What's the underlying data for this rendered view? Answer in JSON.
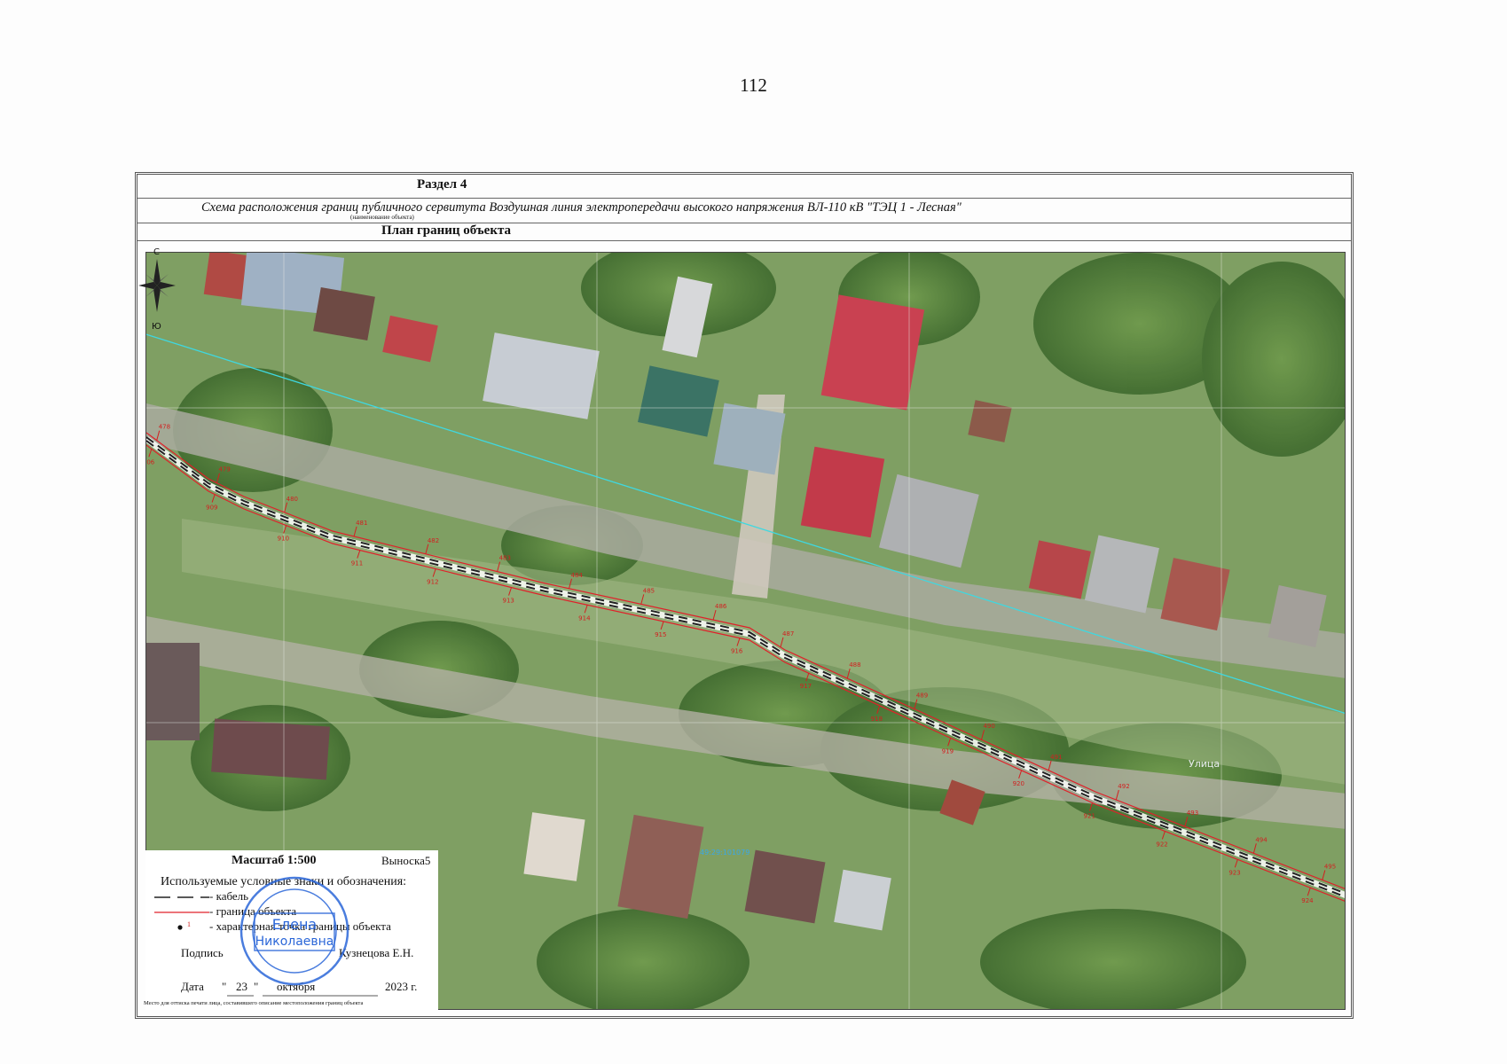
{
  "page_number": "112",
  "header": {
    "section": "Раздел 4",
    "object_name": "Схема расположения границ публичного сервитута Воздушная линия электропередачи высокого напряжения ВЛ-110 кВ \"ТЭЦ 1 - Лесная\"",
    "object_caption": "(наименование объекта)",
    "plan_title": "План границ объекта"
  },
  "compass": {
    "north": "С",
    "south": "Ю"
  },
  "map": {
    "points_upper": [
      "478",
      "479",
      "480",
      "481",
      "482",
      "483",
      "484",
      "485",
      "486",
      "487",
      "488",
      "489",
      "490",
      "491",
      "492",
      "493",
      "494",
      "495"
    ],
    "points_lower": [
      "906",
      "909",
      "910",
      "911",
      "912",
      "913",
      "914",
      "915",
      "916",
      "917",
      "918",
      "919",
      "920",
      "921",
      "922",
      "923",
      "924"
    ],
    "street_label": "Улица",
    "parcel_label": "49:29:101079",
    "colors": {
      "cable": "#222222",
      "boundary": "#e0202a",
      "road_line": "#3fd8e0",
      "label": "#d22020"
    }
  },
  "legend": {
    "scale": "Масштаб 1:500",
    "callout": "Выноска5",
    "title": "Используемые условные знаки и обозначения:",
    "items": [
      {
        "symbol": "dashed-line",
        "text": "- кабель"
      },
      {
        "symbol": "red-line",
        "text": "- граница объекта"
      },
      {
        "symbol": "point",
        "marker_label": "1",
        "text": "- характерная точка границы объекта"
      }
    ],
    "signature_label": "Подпись",
    "signatory": "Кузнецова Е.Н.",
    "date_label": "Дата",
    "date_day": "23",
    "date_month": "октября",
    "date_year": "2023 г.",
    "stamp_note": "Место для оттиска печати лица, составившего описание местоположения границ объекта",
    "stamp_text": [
      "Елена",
      "Николаевна"
    ]
  }
}
